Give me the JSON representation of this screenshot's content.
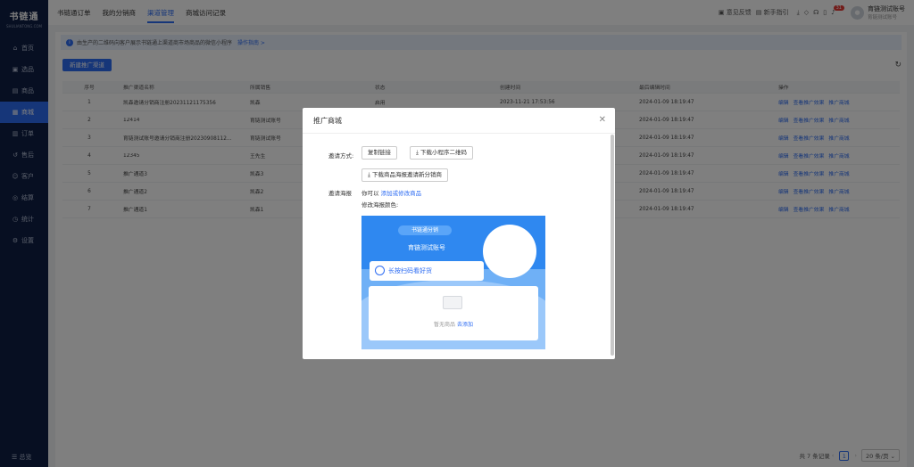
{
  "sidebar": {
    "logo": "书链通",
    "logo_sub": "SHULIANTONG.COM",
    "items": [
      {
        "label": "首页",
        "icon": "home-icon"
      },
      {
        "label": "选品",
        "icon": "select-icon"
      },
      {
        "label": "商品",
        "icon": "goods-icon"
      },
      {
        "label": "商城",
        "icon": "mall-icon"
      },
      {
        "label": "订单",
        "icon": "order-icon"
      },
      {
        "label": "售后",
        "icon": "aftersale-icon"
      },
      {
        "label": "客户",
        "icon": "customer-icon"
      },
      {
        "label": "结算",
        "icon": "settle-icon"
      },
      {
        "label": "统计",
        "icon": "stats-icon"
      },
      {
        "label": "设置",
        "icon": "settings-icon"
      }
    ],
    "active_index": 3,
    "bottom_label": "总览"
  },
  "topbar": {
    "tabs": [
      "书链通订单",
      "我的分销商",
      "渠道管理",
      "商城访问记录"
    ],
    "active_tab": 2,
    "feedback": "意见反馈",
    "guide": "新手指引",
    "badge": "31",
    "account_name": "育链测试账号",
    "account_sub": "育链测试账号"
  },
  "notice": {
    "text": "由生产的二维码向客户展示书链通上渠道商市场商品的微信小程序",
    "link": "操作指南 >"
  },
  "toolbar": {
    "new_button": "新建推广渠道"
  },
  "table": {
    "headers": [
      "序号",
      "推广渠道名称",
      "所属销售",
      "状态",
      "创建时间",
      "最后编辑时间",
      "操作"
    ],
    "rows": [
      [
        "1",
        "凯森邀请分销商注册20231121175356",
        "凯森",
        "启用",
        "2023-11-21 17:53:56",
        "2024-01-09 18:19:47"
      ],
      [
        "2",
        "12414",
        "育链测试账号",
        "",
        "",
        "2024-01-09 18:19:47"
      ],
      [
        "3",
        "育链测试账号邀请分销商注册20230908112...",
        "育链测试账号",
        "",
        "",
        "2024-01-09 18:19:47"
      ],
      [
        "4",
        "12345",
        "王先生",
        "",
        "",
        "2024-01-09 18:19:47"
      ],
      [
        "5",
        "推广通道3",
        "凯森3",
        "",
        "",
        "2024-01-09 18:19:47"
      ],
      [
        "6",
        "推广通道2",
        "凯森2",
        "",
        "",
        "2024-01-09 18:19:47"
      ],
      [
        "7",
        "推广通道1",
        "凯森1",
        "",
        "",
        "2024-01-09 18:19:47"
      ]
    ],
    "actions": [
      "编辑",
      "查看推广效果",
      "推广商城"
    ]
  },
  "pager": {
    "total": "共 7 条记录",
    "page": "1",
    "size": "20 条/页"
  },
  "modal": {
    "title": "推广商城",
    "invite_label": "邀请方式:",
    "copy_link": "复制链接",
    "download_qr": "下载小程序二维码",
    "download_poster": "下载商品海报邀请新分销商",
    "poster_label": "邀请海报",
    "hint": "你可以",
    "hint_link": "添加或修改商品",
    "color_label": "修改海报颜色:",
    "colors": [
      "#2d6cf3",
      "#f0804a",
      "#f0a53a",
      "#8b52e0",
      "#22b8b0"
    ],
    "poster": {
      "pill": "书链通分销",
      "name": "育链测试账号",
      "scan": "长按扫码看好货",
      "empty": "暂无商品",
      "empty_link": "去添加"
    }
  }
}
